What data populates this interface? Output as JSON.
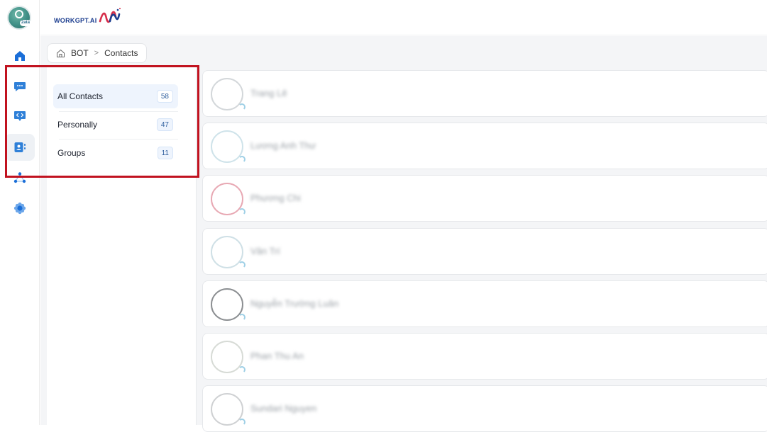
{
  "app": {
    "logo_badge": "2ata",
    "brand_text": "WORKGPT.AI"
  },
  "rail": {
    "items": [
      {
        "name": "home",
        "icon": "home-icon"
      },
      {
        "name": "chat",
        "icon": "chat-bubble-icon"
      },
      {
        "name": "code",
        "icon": "code-bubble-icon"
      },
      {
        "name": "contacts",
        "icon": "contact-card-icon",
        "active": true
      },
      {
        "name": "network",
        "icon": "network-nodes-icon"
      },
      {
        "name": "settings",
        "icon": "gear-icon"
      }
    ]
  },
  "breadcrumb": {
    "home_icon": "home-outline-icon",
    "items": [
      "BOT",
      "Contacts"
    ]
  },
  "filters": {
    "items": [
      {
        "label": "All Contacts",
        "count": "58",
        "active": true
      },
      {
        "label": "Personally",
        "count": "47",
        "active": false
      },
      {
        "label": "Groups",
        "count": "11",
        "active": false
      }
    ]
  },
  "contacts": {
    "items": [
      {
        "name": "Trang Lê",
        "ring_color": "#d3d7da"
      },
      {
        "name": "Lương Anh Thư",
        "ring_color": "#cfe3ea"
      },
      {
        "name": "Phương Chi",
        "ring_color": "#e8a9b4"
      },
      {
        "name": "Văn Trí",
        "ring_color": "#cfe0e6"
      },
      {
        "name": "Nguyễn Trường Luân",
        "ring_color": "#8c8f92"
      },
      {
        "name": "Phan Thu An",
        "ring_color": "#d7dbd6"
      },
      {
        "name": "Sundari Nguyen",
        "ring_color": "#cfd1d3"
      }
    ]
  },
  "colors": {
    "accent": "#1a6ed8",
    "highlight_border": "#c1121f",
    "count_text": "#2f5f9e"
  }
}
